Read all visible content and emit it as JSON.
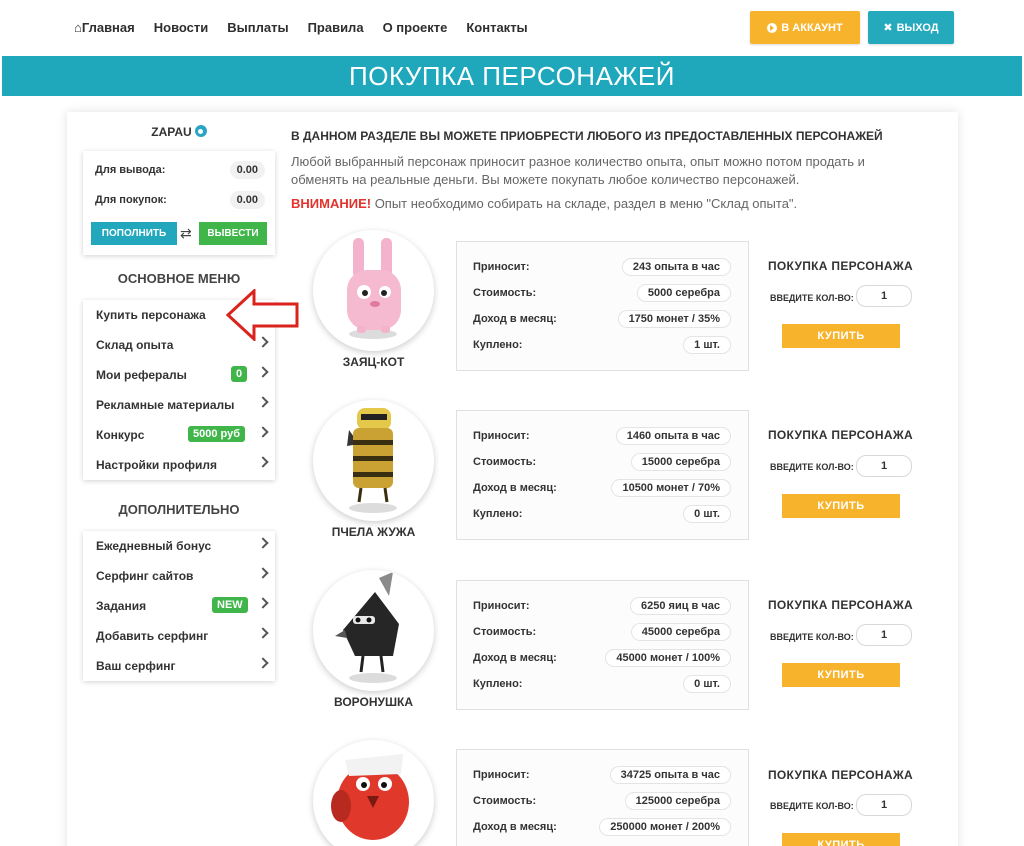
{
  "nav": {
    "items": [
      "Главная",
      "Новости",
      "Выплаты",
      "Правила",
      "О проекте",
      "Контакты"
    ],
    "account_button": "В АККАУНТ",
    "exit_button": "ВЫХОД"
  },
  "banner": {
    "title": "ПОКУПКА ПЕРСОНАЖЕЙ"
  },
  "user": {
    "name": "ZAPAU",
    "withdraw_label": "Для вывода:",
    "withdraw_value": "0.00",
    "purchase_label": "Для покупок:",
    "purchase_value": "0.00",
    "topup_button": "ПОПОЛНИТЬ",
    "withdraw_button": "ВЫВЕСТИ"
  },
  "main_menu": {
    "title": "ОСНОВНОЕ МЕНЮ",
    "items": [
      {
        "label": "Купить персонажа",
        "badge": ""
      },
      {
        "label": "Склад опыта",
        "badge": ""
      },
      {
        "label": "Мои рефералы",
        "badge": "0"
      },
      {
        "label": "Рекламные материалы",
        "badge": ""
      },
      {
        "label": "Конкурс",
        "badge": "5000 руб"
      },
      {
        "label": "Настройки профиля",
        "badge": ""
      }
    ]
  },
  "extra_menu": {
    "title": "ДОПОЛНИТЕЛЬНО",
    "items": [
      {
        "label": "Ежедневный бонус",
        "badge": ""
      },
      {
        "label": "Серфинг сайтов",
        "badge": ""
      },
      {
        "label": "Задания",
        "badge": "NEW"
      },
      {
        "label": "Добавить серфинг",
        "badge": ""
      },
      {
        "label": "Ваш серфинг",
        "badge": ""
      }
    ]
  },
  "content": {
    "heading": "В ДАННОМ РАЗДЕЛЕ ВЫ МОЖЕТЕ ПРИОБРЕСТИ ЛЮБОГО ИЗ ПРЕДОСТАВЛЕННЫХ ПЕРСОНАЖЕЙ",
    "description": "Любой выбранный персонаж приносит разное количество опыта, опыт можно потом продать и обменять на реальные деньги. Вы можете покупать любое количество персонажей.",
    "warning_label": "ВНИМАНИЕ!",
    "warning_text": " Опыт необходимо собирать на складе, раздел в меню \"Склад опыта\".",
    "labels": {
      "brings": "Приносит:",
      "cost": "Стоимость:",
      "income": "Доход в месяц:",
      "bought": "Куплено:",
      "buy_title": "ПОКУПКА ПЕРСОНАЖА",
      "qty_label": "ВВЕДИТЕ КОЛ-ВО:",
      "buy_button": "КУПИТЬ"
    },
    "characters": [
      {
        "name": "ЗАЯЦ-КОТ",
        "brings": "243 опыта в час",
        "cost": "5000 серебра",
        "income": "1750 монет / 35%",
        "bought": "1 шт.",
        "qty": "1"
      },
      {
        "name": "ПЧЕЛА ЖУЖА",
        "brings": "1460 опыта в час",
        "cost": "15000 серебра",
        "income": "10500 монет / 70%",
        "bought": "0 шт.",
        "qty": "1"
      },
      {
        "name": "ВОРОНУШКА",
        "brings": "6250 яиц в час",
        "cost": "45000 серебра",
        "income": "45000 монет / 100%",
        "bought": "0 шт.",
        "qty": "1"
      },
      {
        "name": "",
        "brings": "34725 опыта в час",
        "cost": "125000 серебра",
        "income": "250000 монет / 200%",
        "bought": "",
        "qty": "1"
      }
    ]
  },
  "colors": {
    "accent_teal": "#1fa8bb",
    "accent_orange": "#f7b32b",
    "accent_green": "#3fb54a",
    "warning_red": "#e2332c"
  }
}
